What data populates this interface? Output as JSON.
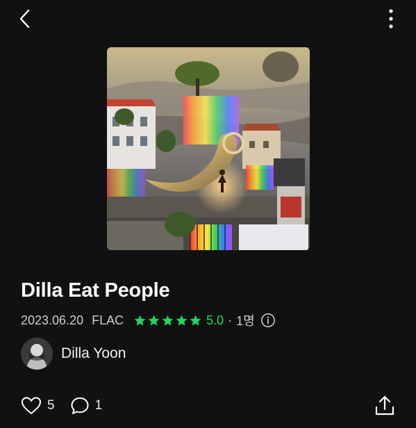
{
  "header": {
    "back_icon": "chevron-left-icon",
    "more_icon": "vertical-dots-icon"
  },
  "album": {
    "cover_description_icon": "album-cover-art",
    "title": "Dilla Eat People",
    "date": "2023.06.20",
    "format": "FLAC",
    "stars": 5,
    "rating": "5.0",
    "separator": "·",
    "rating_count": "1명",
    "info_icon": "info-circle-icon"
  },
  "artist": {
    "name": "Dilla Yoon",
    "avatar_icon": "avatar-icon"
  },
  "actions": {
    "likes": "5",
    "comments": "1",
    "like_icon": "heart-icon",
    "comment_icon": "comment-bubble-icon",
    "share_icon": "share-upload-icon"
  },
  "colors": {
    "background": "#111111",
    "accent_green": "#1ed760",
    "text": "#ffffff",
    "muted_text": "#cfcfcf"
  }
}
